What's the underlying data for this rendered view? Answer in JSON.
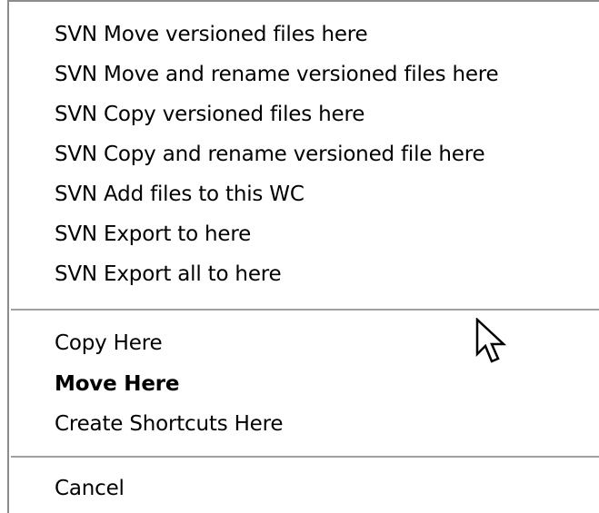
{
  "menu": {
    "svn_items": [
      "SVN Move versioned files here",
      "SVN Move and rename versioned files here",
      "SVN Copy versioned files here",
      "SVN Copy and rename versioned file here",
      "SVN Add files to this WC",
      "SVN Export to here",
      "SVN Export all to here"
    ],
    "standard_items": {
      "copy_here": "Copy Here",
      "move_here": "Move Here",
      "create_shortcuts_here": "Create Shortcuts Here"
    },
    "cancel": "Cancel"
  },
  "icons": {
    "cursor": "arrow-cursor-icon"
  }
}
